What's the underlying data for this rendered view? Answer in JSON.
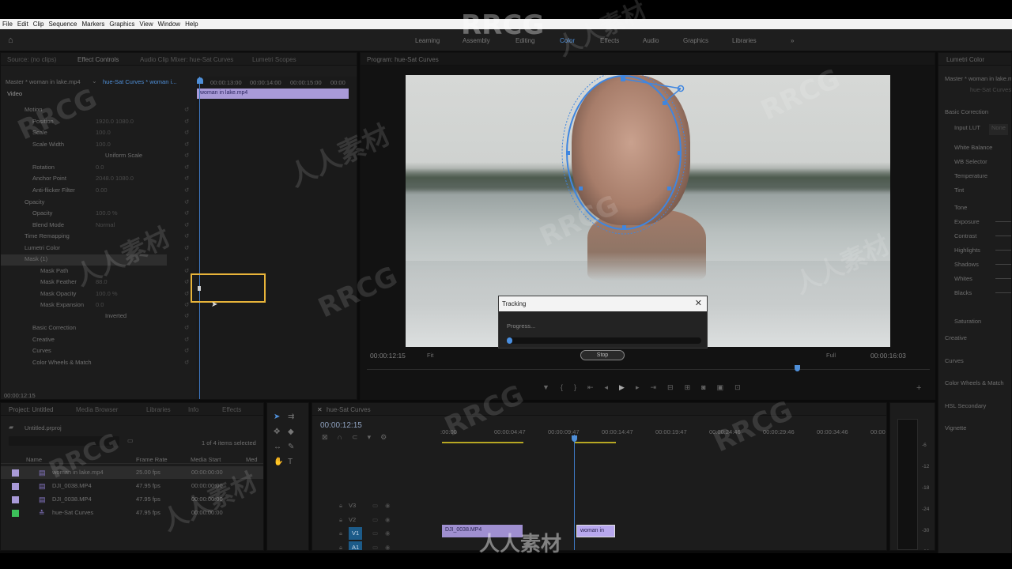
{
  "menu": [
    "File",
    "Edit",
    "Clip",
    "Sequence",
    "Markers",
    "Graphics",
    "View",
    "Window",
    "Help"
  ],
  "workspaces": [
    "Learning",
    "Assembly",
    "Editing",
    "Color",
    "Effects",
    "Audio",
    "Graphics",
    "Libraries"
  ],
  "watermark": {
    "logo": "RRCG",
    "cn": "人人素材"
  },
  "effect_controls": {
    "tabs": [
      "Source: (no clips)",
      "Effect Controls",
      "Audio Clip Mixer: hue-Sat Curves",
      "Lumetri Scopes"
    ],
    "master_label": "Master * woman in lake.mp4",
    "seq_label": "hue-Sat Curves * woman i...",
    "timecodes": [
      "00:00:13:00",
      "00:00:14:00",
      "00:00:15:00",
      "00:00"
    ],
    "clip_label": "woman in lake.mp4",
    "section": "Video",
    "rows": [
      {
        "name": "Motion",
        "value": ""
      },
      {
        "name": "Position",
        "value": "1920.0    1080.0"
      },
      {
        "name": "Scale",
        "value": "100.0"
      },
      {
        "name": "Scale Width",
        "value": "100.0"
      },
      {
        "name": "Uniform Scale",
        "value": ""
      },
      {
        "name": "Rotation",
        "value": "0.0"
      },
      {
        "name": "Anchor Point",
        "value": "2048.0    1080.0"
      },
      {
        "name": "Anti-flicker Filter",
        "value": "0.00"
      },
      {
        "name": "Opacity",
        "value": ""
      },
      {
        "name": "Opacity",
        "value": "100.0 %"
      },
      {
        "name": "Blend Mode",
        "value": "Normal"
      },
      {
        "name": "Time Remapping",
        "value": ""
      },
      {
        "name": "Lumetri Color",
        "value": ""
      },
      {
        "name": "Mask (1)",
        "value": ""
      },
      {
        "name": "Mask Path",
        "value": ""
      },
      {
        "name": "Mask Feather",
        "value": "88.0"
      },
      {
        "name": "Mask Opacity",
        "value": "100.0 %"
      },
      {
        "name": "Mask Expansion",
        "value": "0.0"
      },
      {
        "name": "Inverted",
        "value": ""
      },
      {
        "name": "Basic Correction",
        "value": ""
      },
      {
        "name": "Creative",
        "value": ""
      },
      {
        "name": "Curves",
        "value": ""
      },
      {
        "name": "Color Wheels & Match",
        "value": ""
      }
    ],
    "bottom_tc": "00:00:12:15"
  },
  "program": {
    "tab": "Program: hue-Sat Curves",
    "tc_left": "00:00:12:15",
    "fit": "Fit",
    "tc_right": "00:00:16:03",
    "quality": "Full"
  },
  "tracking": {
    "title": "Tracking",
    "progress_label": "Progress...",
    "progress": 0.03,
    "stop": "Stop"
  },
  "lumetri": {
    "tab": "Lumetri Color",
    "master": "Master * woman in lake.mp4",
    "seq": "hue-Sat Curves",
    "basic": "Basic Correction",
    "input_lut": "Input LUT",
    "input_lut_value": "None",
    "items": [
      "White Balance",
      "WB Selector",
      "Temperature",
      "Tint"
    ],
    "tone": "Tone",
    "tone_items": [
      "Exposure",
      "Contrast",
      "Highlights",
      "Shadows",
      "Whites",
      "Blacks"
    ],
    "saturation": "Saturation",
    "sections": [
      "Creative",
      "Curves",
      "Color Wheels & Match",
      "HSL Secondary",
      "Vignette"
    ]
  },
  "project": {
    "tabs": [
      "Project: Untitled",
      "Media Browser",
      "Libraries",
      "Info",
      "Effects"
    ],
    "file": "Untitled.prproj",
    "count": "1 of 4 items selected",
    "headers": [
      "Name",
      "Frame Rate",
      "Media Start",
      "Med"
    ],
    "rows": [
      {
        "name": "woman in lake.mp4",
        "fps": "25.00 fps",
        "start": "00:00:00:00",
        "color": "#a99ad8"
      },
      {
        "name": "DJI_0038.MP4",
        "fps": "47.95 fps",
        "start": "00:00:00:00",
        "color": "#a99ad8"
      },
      {
        "name": "DJI_0038.MP4",
        "fps": "47.95 fps",
        "start": "00:00:00:00",
        "color": "#a99ad8"
      },
      {
        "name": "hue-Sat Curves",
        "fps": "47.95 fps",
        "start": "00:00:00:00",
        "color": "#3cc05a"
      }
    ]
  },
  "timeline": {
    "tab": "hue-Sat Curves",
    "tc": "00:00:12:15",
    "ruler": [
      ":00:00",
      "00:00:04:47",
      "00:00:09:47",
      "00:00:14:47",
      "00:00:19:47",
      "00:00:24:46",
      "00:00:29:46",
      "00:00:34:46",
      "00:00"
    ],
    "tracks": [
      "V3",
      "V2",
      "V1",
      "A1"
    ],
    "clips": [
      {
        "label": "DJI_0038.MP4"
      },
      {
        "label": "woman in"
      }
    ]
  },
  "meter_ticks": [
    "-6",
    "-12",
    "-18",
    "-24",
    "-30",
    "-36"
  ]
}
